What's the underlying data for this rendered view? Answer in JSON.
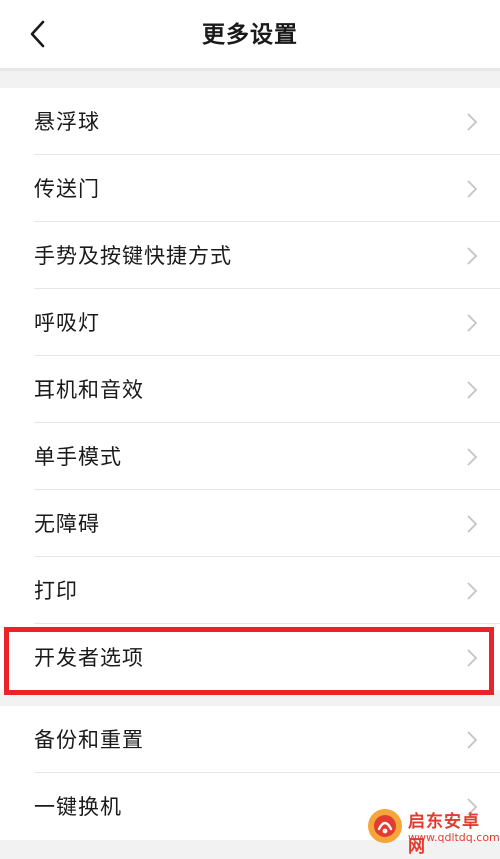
{
  "header": {
    "title": "更多设置"
  },
  "settings": {
    "group1": [
      {
        "label": "悬浮球"
      },
      {
        "label": "传送门"
      },
      {
        "label": "手势及按键快捷方式"
      },
      {
        "label": "呼吸灯"
      },
      {
        "label": "耳机和音效"
      },
      {
        "label": "单手模式"
      },
      {
        "label": "无障碍"
      },
      {
        "label": "打印"
      },
      {
        "label": "开发者选项"
      }
    ],
    "group2": [
      {
        "label": "备份和重置"
      },
      {
        "label": "一键换机"
      }
    ]
  },
  "highlight": {
    "target": "开发者选项",
    "color": "#e8242a"
  },
  "watermark": {
    "name": "启东安卓网",
    "url": "www.qdltdq.com"
  },
  "colors": {
    "background": "#f2f2f2",
    "row": "#ffffff",
    "chevron": "#c4c4c4",
    "divider": "#e6e6e6"
  }
}
